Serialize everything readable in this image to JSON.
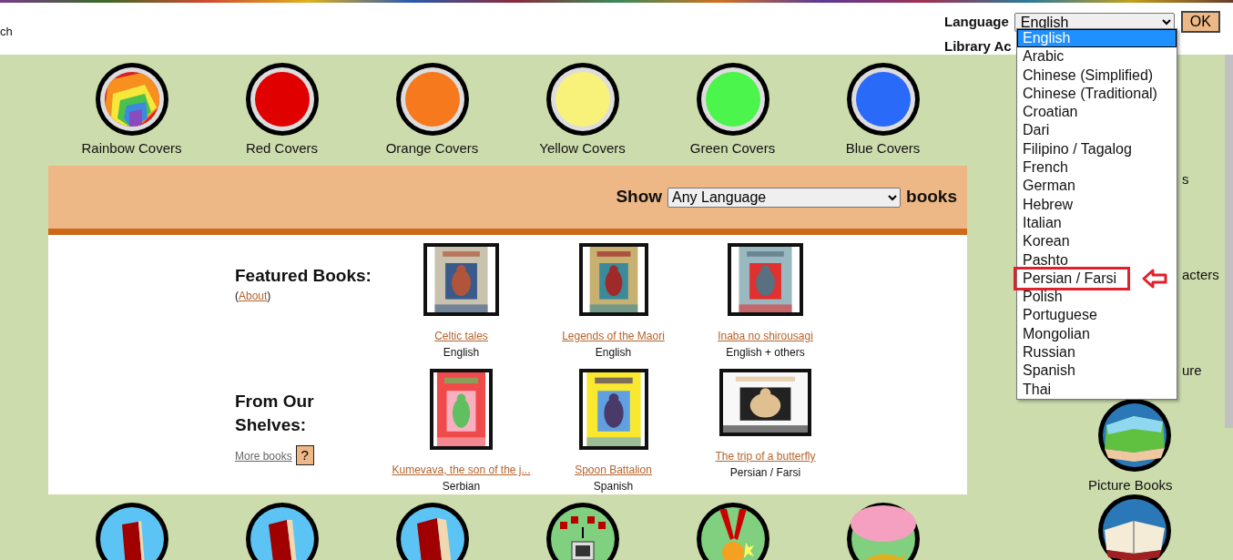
{
  "top_left_text": "ch",
  "language": {
    "label": "Language",
    "value": "English",
    "button": "OK"
  },
  "library_label": "Library Ac",
  "language_menu": [
    {
      "label": "English",
      "selected": true,
      "highlighted": false
    },
    {
      "label": "Arabic",
      "selected": false,
      "highlighted": false
    },
    {
      "label": "Chinese (Simplified)",
      "selected": false,
      "highlighted": false
    },
    {
      "label": "Chinese (Traditional)",
      "selected": false,
      "highlighted": false
    },
    {
      "label": "Croatian",
      "selected": false,
      "highlighted": false
    },
    {
      "label": "Dari",
      "selected": false,
      "highlighted": false
    },
    {
      "label": "Filipino / Tagalog",
      "selected": false,
      "highlighted": false
    },
    {
      "label": "French",
      "selected": false,
      "highlighted": false
    },
    {
      "label": "German",
      "selected": false,
      "highlighted": false
    },
    {
      "label": "Hebrew",
      "selected": false,
      "highlighted": false
    },
    {
      "label": "Italian",
      "selected": false,
      "highlighted": false
    },
    {
      "label": "Korean",
      "selected": false,
      "highlighted": false
    },
    {
      "label": "Pashto",
      "selected": false,
      "highlighted": false
    },
    {
      "label": "Persian / Farsi",
      "selected": false,
      "highlighted": true
    },
    {
      "label": "Polish",
      "selected": false,
      "highlighted": false
    },
    {
      "label": "Portuguese",
      "selected": false,
      "highlighted": false
    },
    {
      "label": "Mongolian",
      "selected": false,
      "highlighted": false
    },
    {
      "label": "Russian",
      "selected": false,
      "highlighted": false
    },
    {
      "label": "Spanish",
      "selected": false,
      "highlighted": false
    },
    {
      "label": "Thai",
      "selected": false,
      "highlighted": false
    }
  ],
  "cover_colors": [
    {
      "label": "Rainbow Covers",
      "kind": "rainbow"
    },
    {
      "label": "Red Covers",
      "kind": "solid",
      "color": "#e00000"
    },
    {
      "label": "Orange Covers",
      "kind": "solid",
      "color": "#f7791e"
    },
    {
      "label": "Yellow Covers",
      "kind": "solid",
      "color": "#f8f27a"
    },
    {
      "label": "Green Covers",
      "kind": "solid",
      "color": "#4cf54c"
    },
    {
      "label": "Blue Covers",
      "kind": "solid",
      "color": "#2a6af8"
    }
  ],
  "filter": {
    "prefix": "Show",
    "value": "Any Language",
    "suffix": "books"
  },
  "featured": {
    "title": "Featured Books:",
    "about_open": "(",
    "about": "About",
    "about_close": ")",
    "books": [
      {
        "title": "Celtic tales",
        "language": "English"
      },
      {
        "title": "Legends of the Maori",
        "language": "English"
      },
      {
        "title": "Inaba no shirousagi",
        "language": "English + others"
      }
    ]
  },
  "shelves": {
    "title": "From Our Shelves:",
    "more": "More books",
    "help": "?",
    "books": [
      {
        "title": "Kumevava, the son of the j...",
        "language": "Serbian"
      },
      {
        "title": "Spoon Battalion",
        "language": "Spanish"
      },
      {
        "title": "The trip of a butterfly",
        "language": "Persian / Farsi"
      }
    ]
  },
  "side_labels": [
    "s",
    "acters",
    "ure",
    "Picture Books"
  ],
  "bottom_icons": [
    {
      "kind": "book-thin"
    },
    {
      "kind": "book"
    },
    {
      "kind": "book-thick"
    },
    {
      "kind": "computer"
    },
    {
      "kind": "medal"
    },
    {
      "kind": "lamp"
    }
  ]
}
